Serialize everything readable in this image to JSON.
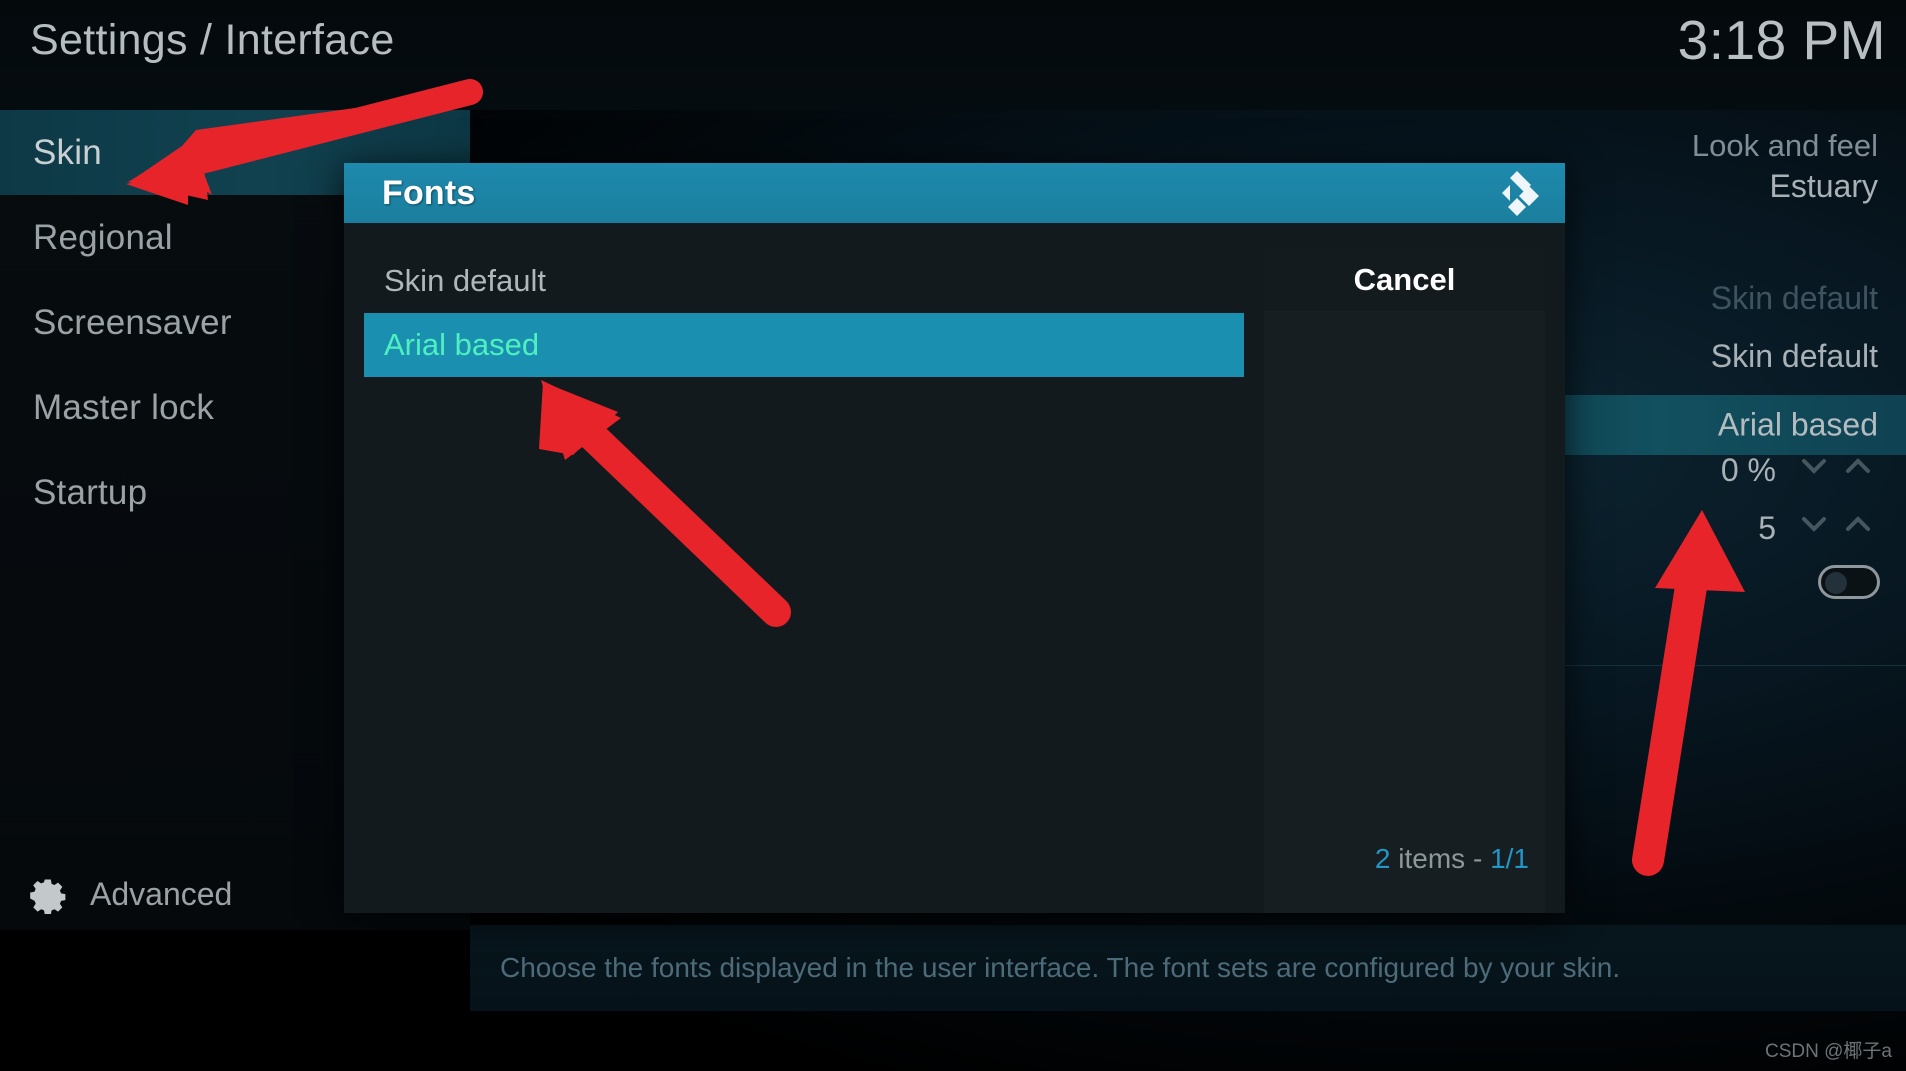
{
  "header": {
    "page_title": "Settings / Interface",
    "clock": "3:18 PM"
  },
  "sidebar": {
    "items": [
      {
        "label": "Skin",
        "selected": true
      },
      {
        "label": "Regional",
        "selected": false
      },
      {
        "label": "Screensaver",
        "selected": false
      },
      {
        "label": "Master lock",
        "selected": false
      },
      {
        "label": "Startup",
        "selected": false
      }
    ],
    "advanced_label": "Advanced",
    "gear_icon": "gear-icon"
  },
  "background_panel": {
    "section_heading": "Look and feel",
    "rows": [
      {
        "value": "Estuary",
        "state": "normal"
      },
      {
        "value": "Skin default",
        "state": "dimmed"
      },
      {
        "value": "Skin default",
        "state": "normal"
      },
      {
        "value": "Arial based",
        "state": "highlighted"
      },
      {
        "value": "0 %",
        "state": "spinner"
      },
      {
        "value": "5",
        "state": "spinner"
      },
      {
        "value": "",
        "state": "toggle-off"
      }
    ]
  },
  "description": {
    "text": "Choose the fonts displayed in the user interface. The font sets are configured by your skin."
  },
  "dialog": {
    "title": "Fonts",
    "logo_icon": "kodi-logo-icon",
    "options": [
      {
        "label": "Skin default",
        "selected": false
      },
      {
        "label": "Arial based",
        "selected": true
      }
    ],
    "cancel_label": "Cancel",
    "count": {
      "total": "2",
      "items_label": "items -",
      "page": "1/1"
    }
  },
  "annotations": {
    "arrow_color": "#e8242b",
    "arrows": [
      {
        "name": "arrow-to-skin",
        "points_to": "sidebar-item-skin"
      },
      {
        "name": "arrow-to-arial-based-option",
        "points_to": "dialog-option-arial-based"
      },
      {
        "name": "arrow-to-arial-based-value",
        "points_to": "settings-row-font-value"
      }
    ]
  },
  "watermark": {
    "text": "CSDN @椰子a"
  },
  "colors": {
    "accent_teal": "#1b8fb0",
    "highlight_green": "#4ef0c0",
    "arrow_red": "#e8242b",
    "count_blue": "#2196c7"
  }
}
